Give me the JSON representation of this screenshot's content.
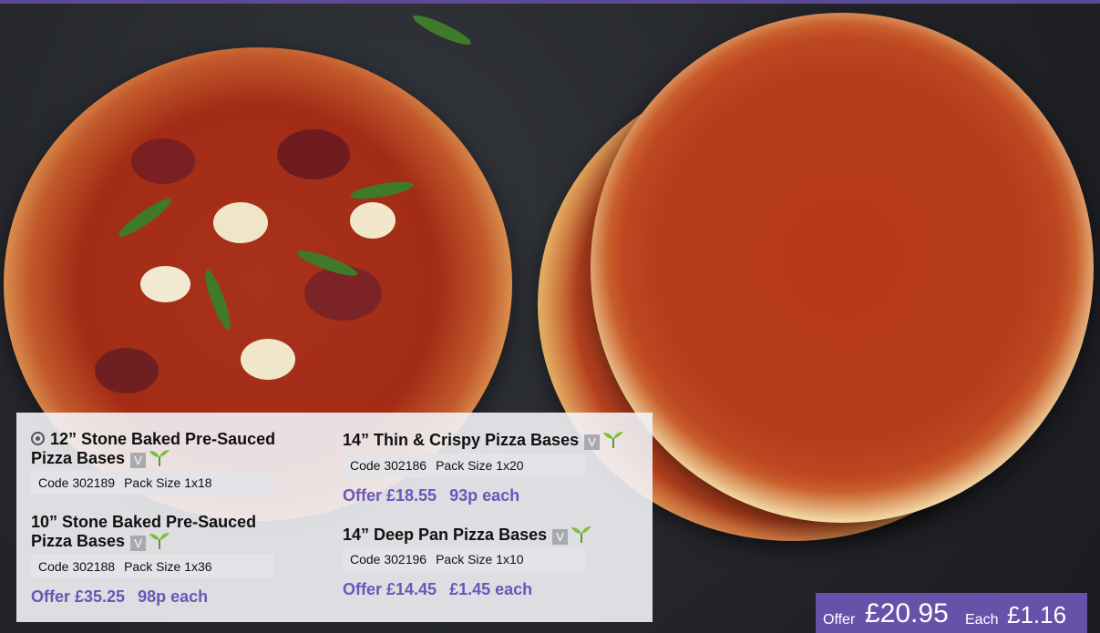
{
  "products": [
    {
      "title_line1": "12” Stone Baked Pre-Sauced",
      "title_line2": "Pizza Bases",
      "vegetarian": "V",
      "code": "Code 302189",
      "pack": "Pack Size 1x18",
      "icon": "camera-icon"
    },
    {
      "title_line1": "10” Stone Baked Pre-Sauced",
      "title_line2": "Pizza Bases",
      "vegetarian": "V",
      "code": "Code 302188",
      "pack": "Pack Size 1x36",
      "offer_price": "Offer £35.25",
      "each_price": "98p each"
    },
    {
      "title": "14” Thin & Crispy Pizza Bases",
      "vegetarian": "V",
      "code": "Code 302186",
      "pack": "Pack Size 1x20",
      "offer_price": "Offer £18.55",
      "each_price": "93p each"
    },
    {
      "title": "14” Deep Pan Pizza Bases",
      "vegetarian": "V",
      "code": "Code 302196",
      "pack": "Pack Size 1x10",
      "offer_price": "Offer £14.45",
      "each_price": "£1.45 each"
    }
  ],
  "feature_offer": {
    "offer_label": "Offer",
    "offer_price": "£20.95",
    "each_label": "Each",
    "each_price": "£1.16"
  },
  "colors": {
    "accent": "#6752aa",
    "offer_text": "#6a56b8",
    "panel_bg": "#f2f2f6"
  }
}
